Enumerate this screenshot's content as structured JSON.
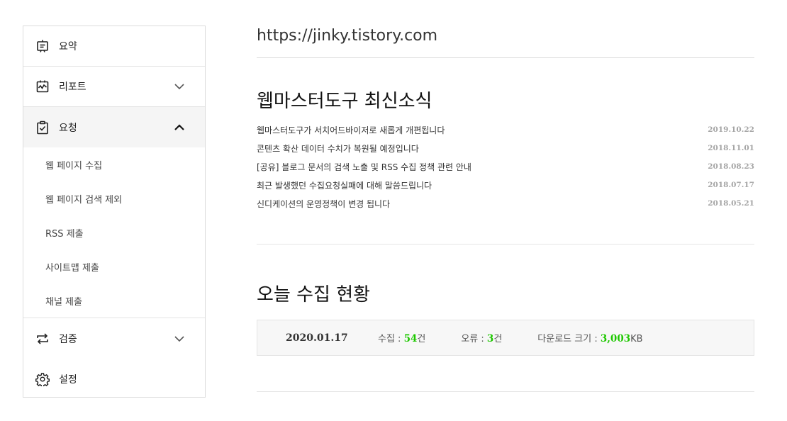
{
  "sidebar": {
    "items": [
      {
        "label": "요약",
        "icon": "summary-icon"
      },
      {
        "label": "리포트",
        "icon": "report-icon",
        "chevron": "chevron-down-icon"
      },
      {
        "label": "요청",
        "icon": "request-icon",
        "chevron": "chevron-up-icon",
        "active": true
      },
      {
        "label": "검증",
        "icon": "verify-icon",
        "chevron": "chevron-down-icon"
      },
      {
        "label": "설정",
        "icon": "gear-icon"
      }
    ],
    "submenu": [
      {
        "label": "웹 페이지 수집"
      },
      {
        "label": "웹 페이지 검색 제외"
      },
      {
        "label": "RSS 제출"
      },
      {
        "label": "사이트맵 제출"
      },
      {
        "label": "채널 제출"
      }
    ]
  },
  "main": {
    "site_url": "https://jinky.tistory.com",
    "news_title": "웹마스터도구 최신소식",
    "news": [
      {
        "text": "웹마스터도구가 서치어드바이저로 새롭게 개편됩니다",
        "date": "2019.10.22"
      },
      {
        "text": "콘텐츠 확산 데이터 수치가 복원될 예정입니다",
        "date": "2018.11.01"
      },
      {
        "text": "[공유] 블로그 문서의 검색 노출 및 RSS 수집 정책 관련 안내",
        "date": "2018.08.23"
      },
      {
        "text": "최근 발생했던 수집요청실패에 대해 말씀드립니다",
        "date": "2018.07.17"
      },
      {
        "text": "신디케이션의 운영정책이 변경 됩니다",
        "date": "2018.05.21"
      }
    ],
    "today_title": "오늘 수집 현황",
    "stats": {
      "date": "2020.01.17",
      "collect_label": "수집 : ",
      "collect_value": "54",
      "collect_unit": "건",
      "error_label": "오류 : ",
      "error_value": "3",
      "error_unit": "건",
      "download_label": "다운로드 크기 : ",
      "download_value": "3,003",
      "download_unit": "KB",
      "accent_color": "#1ec800"
    }
  }
}
